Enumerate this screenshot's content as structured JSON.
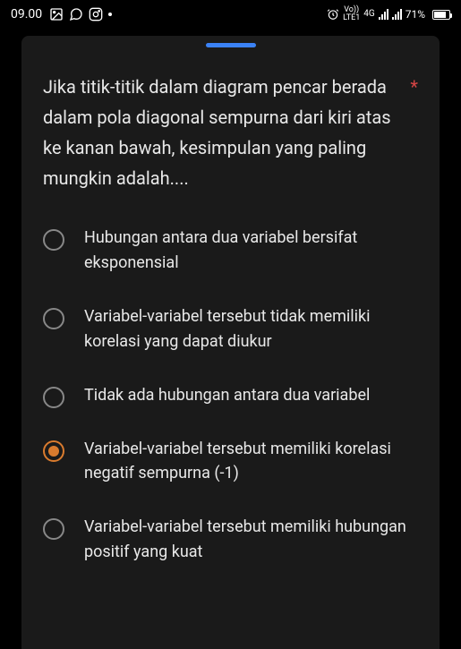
{
  "status": {
    "time": "09.00",
    "network_label1": "Vo))",
    "network_label2": "LTE1",
    "network_type": "4G",
    "battery_percent": "71%"
  },
  "card": {
    "required_marker": "*",
    "question": "Jika titik-titik dalam diagram pencar berada dalam pola diagonal sempurna dari kiri atas ke kanan bawah, kesimpulan yang paling mungkin adalah....",
    "options": [
      {
        "text": "Hubungan antara dua variabel bersifat eksponensial",
        "selected": false
      },
      {
        "text": "Variabel-variabel tersebut tidak memiliki korelasi yang dapat diukur",
        "selected": false
      },
      {
        "text": "Tidak ada hubungan antara dua variabel",
        "selected": false
      },
      {
        "text": "Variabel-variabel tersebut memiliki korelasi negatif sempurna (-1)",
        "selected": true
      },
      {
        "text": "Variabel-variabel tersebut memiliki hubungan positif yang kuat",
        "selected": false
      }
    ]
  }
}
